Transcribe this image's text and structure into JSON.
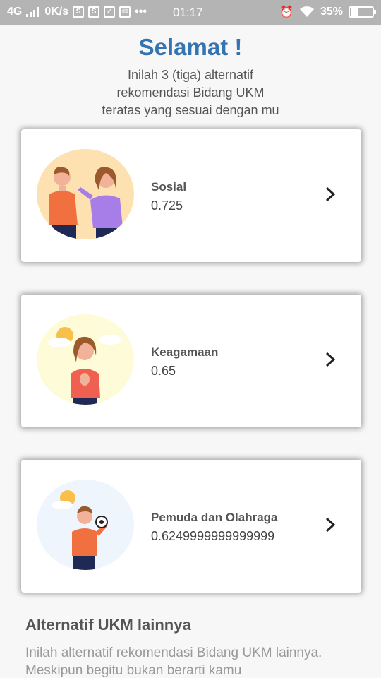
{
  "status_bar": {
    "network": "4G",
    "speed": "0K/s",
    "time": "01:17",
    "battery": "35%",
    "battery_level": 0.35
  },
  "header": {
    "title": "Selamat !",
    "subtitle_lines": [
      "Inilah 3 (tiga) alternatif",
      "rekomendasi Bidang UKM",
      "teratas yang sesuai dengan mu"
    ]
  },
  "recommendations": [
    {
      "name": "Sosial",
      "score": "0.725",
      "icon": "two-people-talking-illustration",
      "bg": "#fde1b0"
    },
    {
      "name": "Keagamaan",
      "score": "0.65",
      "icon": "praying-woman-illustration",
      "bg": "#fdfbd8"
    },
    {
      "name": "Pemuda dan Olahraga",
      "score": "0.6249999999999999",
      "icon": "boy-with-soccer-ball-illustration",
      "bg": "#eef5fc"
    }
  ],
  "other_section": {
    "title": "Alternatif UKM lainnya",
    "description": "Inilah alternatif rekomendasi Bidang UKM lainnya. Meskipun begitu bukan berarti kamu"
  },
  "colors": {
    "title": "#3474b0",
    "status_bar": "#b4b4b4"
  }
}
